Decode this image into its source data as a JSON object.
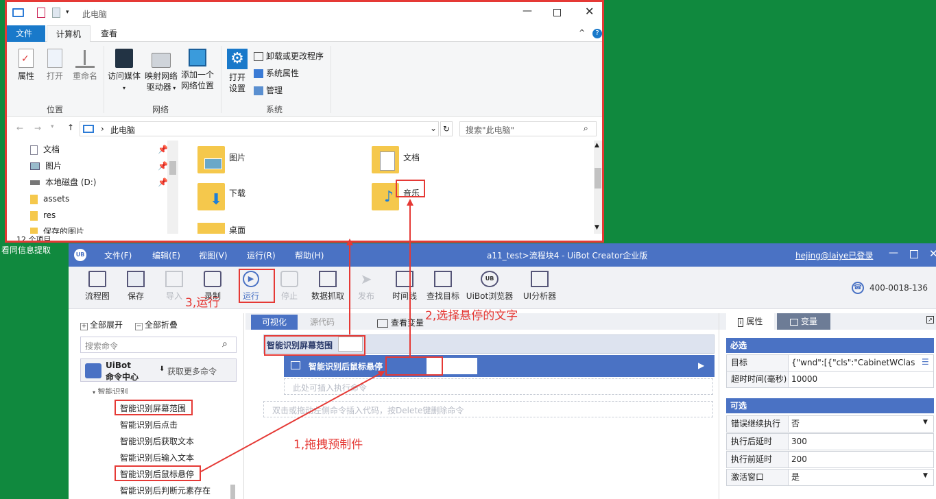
{
  "explorer": {
    "title": "此电脑",
    "tabs": [
      "文件",
      "计算机",
      "查看"
    ],
    "ribbon": {
      "location": {
        "properties": "属性",
        "open": "打开",
        "rename": "重命名",
        "group": "位置"
      },
      "network": {
        "media": "访问媒体",
        "map_drive_1": "映射网络",
        "map_drive_2": "驱动器",
        "add_loc_1": "添加一个",
        "add_loc_2": "网络位置",
        "group": "网络"
      },
      "system": {
        "open_settings_1": "打开",
        "open_settings_2": "设置",
        "uninstall": "卸载或更改程序",
        "sys_props": "系统属性",
        "manage": "管理",
        "group": "系统"
      }
    },
    "address": "此电脑",
    "search_placeholder": "搜索\"此电脑\"",
    "nav": [
      "文档",
      "图片",
      "本地磁盘 (D:)",
      "assets",
      "res",
      "保存的图片"
    ],
    "folders": [
      "图片",
      "文档",
      "下载",
      "音乐",
      "桌面"
    ],
    "status": "12 个项目"
  },
  "bg_label": "看同信息提取",
  "uibot": {
    "title": "a11_test>流程块4 - UiBot Creator企业版",
    "user": "hejing@laiye已登录",
    "menu": [
      "文件(F)",
      "编辑(E)",
      "视图(V)",
      "运行(R)",
      "帮助(H)"
    ],
    "toolbar": [
      "流程图",
      "保存",
      "导入",
      "录制",
      "运行",
      "停止",
      "数据抓取",
      "发布",
      "时间线",
      "查找目标",
      "UiBot浏览器",
      "UI分析器"
    ],
    "phone": "400-0018-136",
    "left": {
      "expand_all": "全部展开",
      "collapse_all": "全部折叠",
      "search_placeholder": "搜索命令",
      "center_title_1": "UiBot",
      "center_title_2": "命令中心",
      "more_commands": "获取更多命令",
      "category": "智能识别",
      "commands": [
        "智能识别屏幕范围",
        "智能识别后点击",
        "智能识别后获取文本",
        "智能识别后输入文本",
        "智能识别后鼠标悬停",
        "智能识别后判断元素存在"
      ]
    },
    "center": {
      "tabs": [
        "可视化",
        "源代码"
      ],
      "view_vars": "查看变量",
      "block_outer": "智能识别屏幕范围",
      "block_inner": "智能识别后鼠标悬停",
      "insert_here": "此处可插入执行命令",
      "hint": "双击或拖动左侧命令插入代码，按Delete键删除命令"
    },
    "right": {
      "tabs": [
        "属性",
        "变量"
      ],
      "required": "必选",
      "optional": "可选",
      "props_required": [
        {
          "label": "目标",
          "value": "{\"wnd\":[{\"cls\":\"CabinetWClass\",'"
        },
        {
          "label": "超时时间(毫秒)",
          "value": "10000"
        }
      ],
      "props_optional": [
        {
          "label": "错误继续执行",
          "value": "否"
        },
        {
          "label": "执行后延时",
          "value": "300"
        },
        {
          "label": "执行前延时",
          "value": "200"
        },
        {
          "label": "激活窗口",
          "value": "是"
        }
      ]
    }
  },
  "annotations": {
    "a1": "1,拖拽预制件",
    "a2": "2,选择悬停的文字",
    "a3": "3,运行"
  }
}
